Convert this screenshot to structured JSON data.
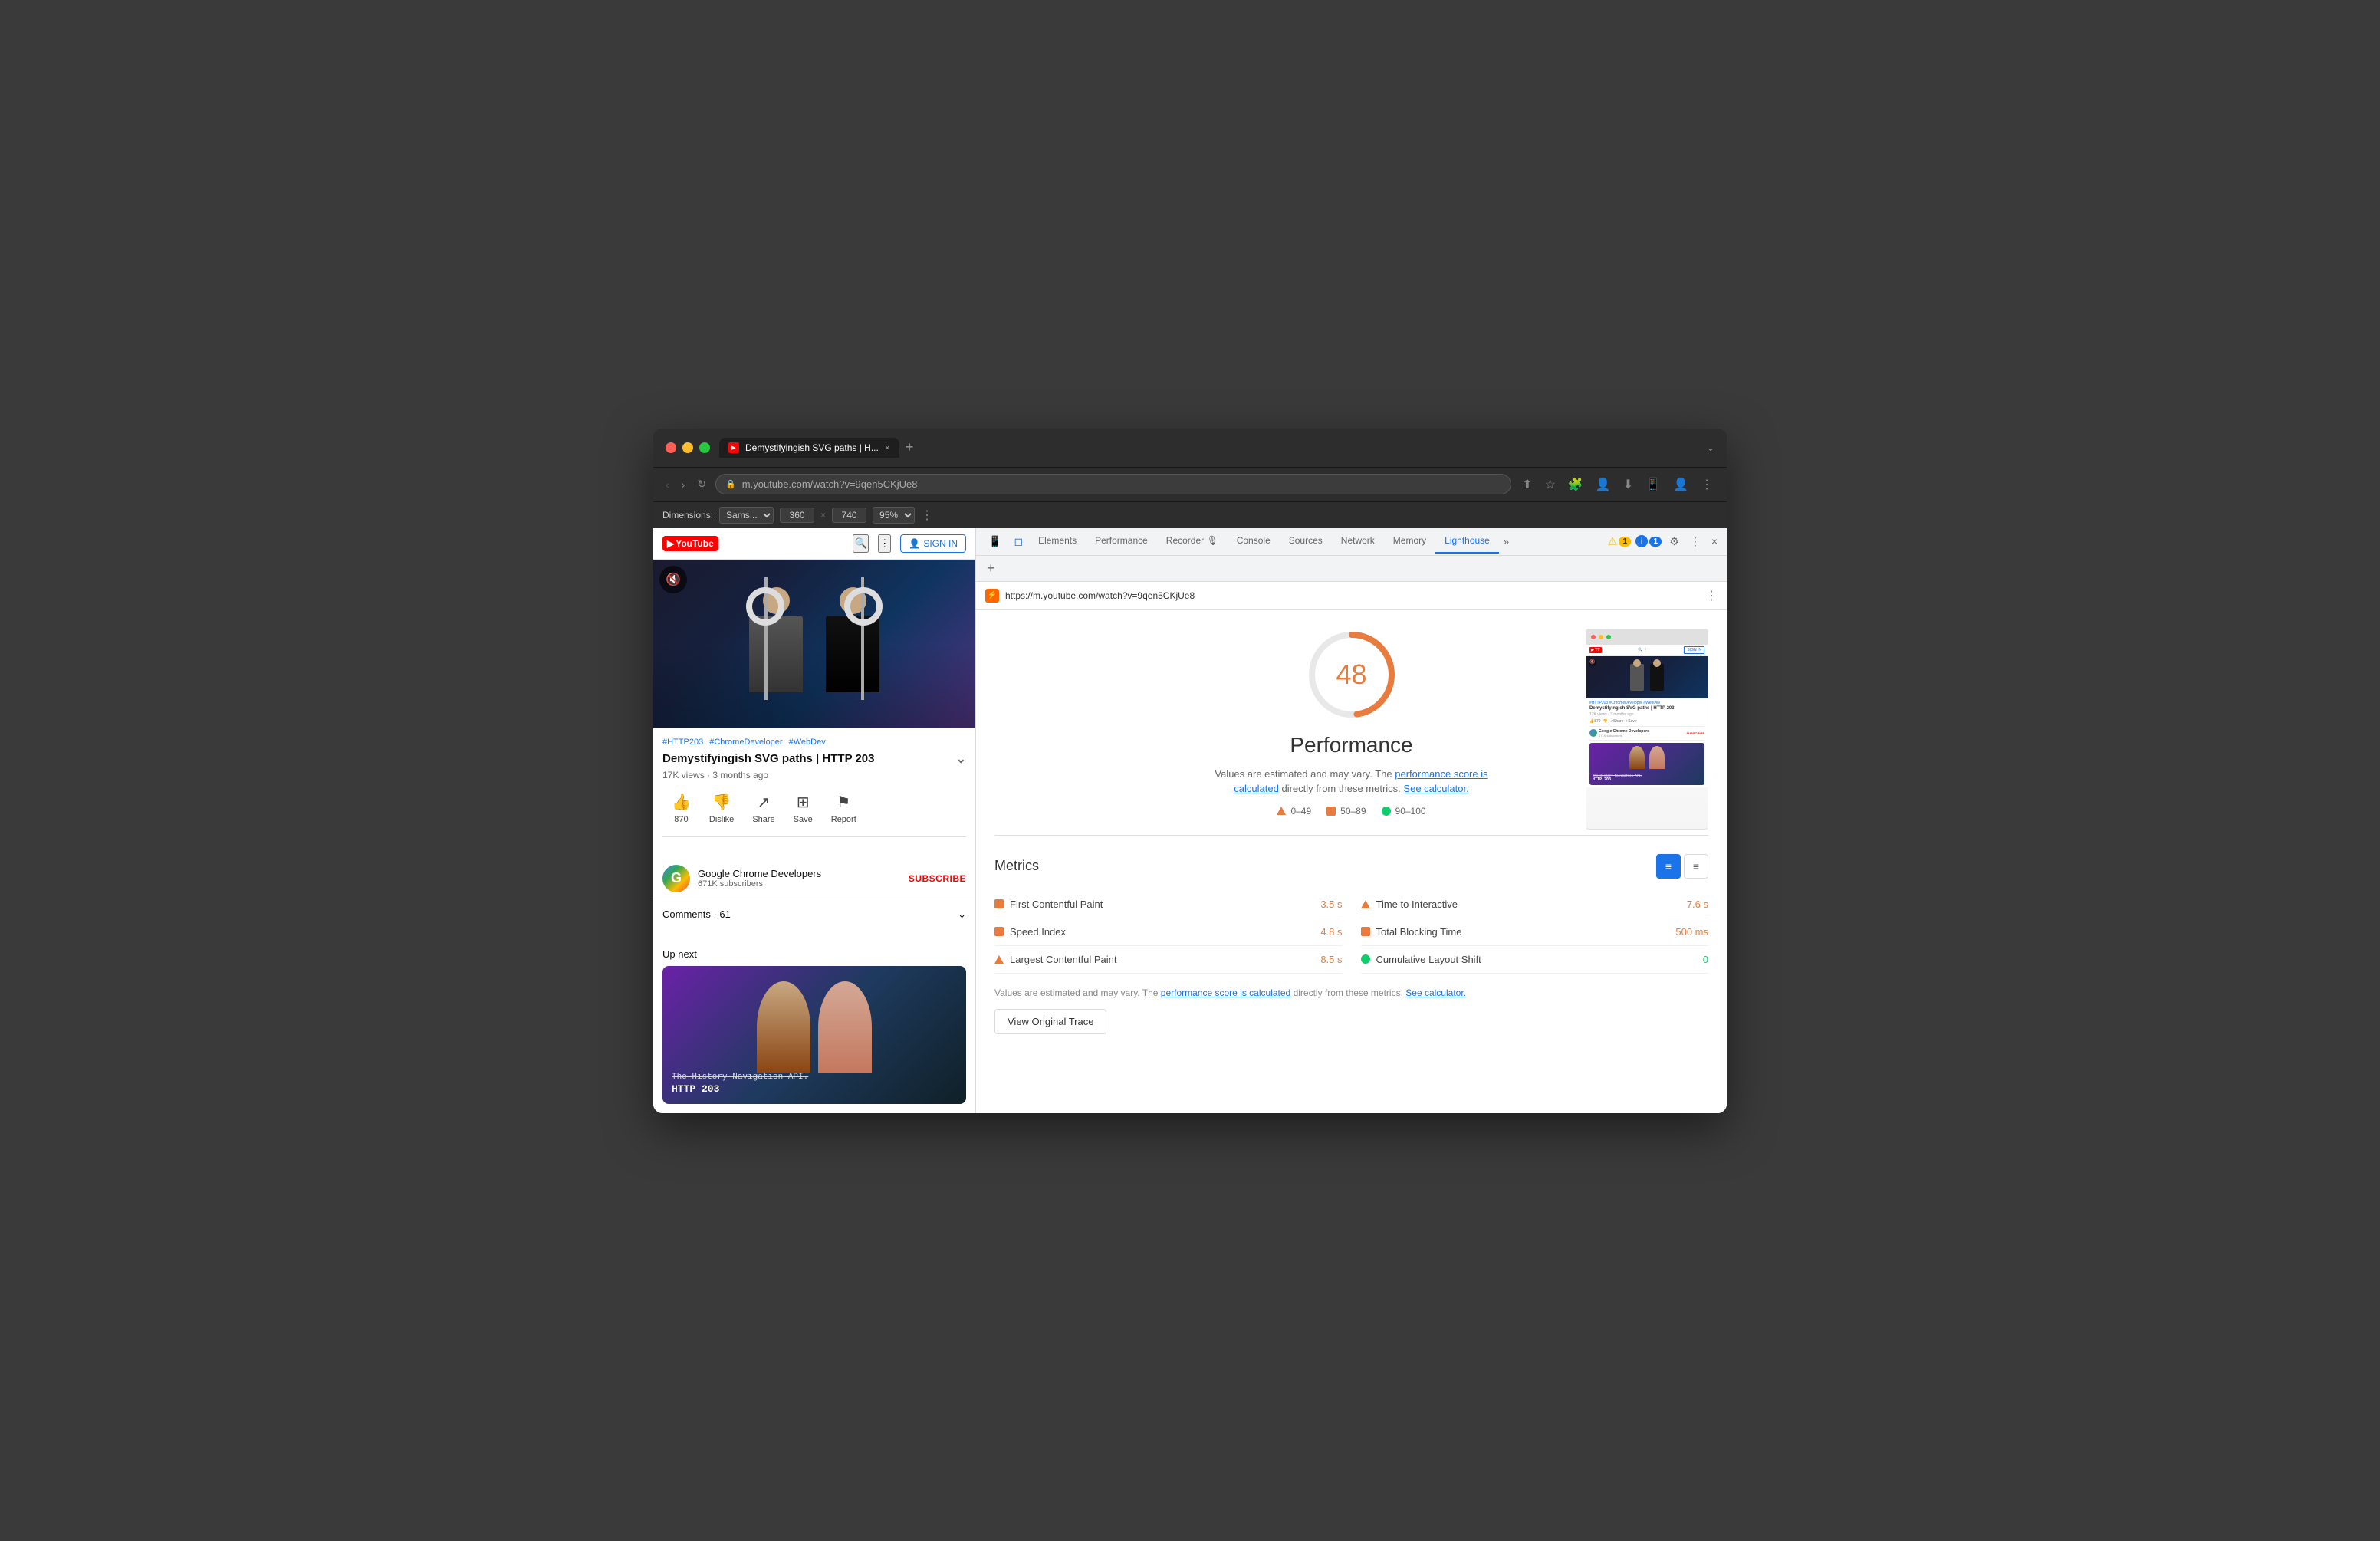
{
  "browser": {
    "traffic_lights": {
      "red": "close",
      "yellow": "minimize",
      "green": "maximize"
    },
    "tab": {
      "title": "Demystifyingish SVG paths | H...",
      "favicon": "youtube-favicon",
      "close": "×"
    },
    "nav": {
      "back": "‹",
      "forward": "›",
      "refresh": "↻",
      "url_full": "m.youtube.com/watch?v=9qen5CKjUe8",
      "url_protocol": "m.youtube.com",
      "url_path": "/watch?v=9qen5CKjUe8"
    },
    "nav_actions": {
      "share": "⬆",
      "bookmark": "☆",
      "extensions": "🧩",
      "person": "👤",
      "download": "⬇",
      "mobile": "📱",
      "profile": "👤",
      "menu": "⋮",
      "chevron": "⌄"
    }
  },
  "dimensions": {
    "label": "Dimensions:",
    "device": "Sams...",
    "width": "360",
    "height": "740",
    "zoom": "95%",
    "menu": "⋮"
  },
  "devtools": {
    "tabs": [
      "Elements",
      "Performance",
      "Recorder 🎙",
      "Console",
      "Sources",
      "Network",
      "Memory",
      "Lighthouse"
    ],
    "active_tab": "Lighthouse",
    "more_tabs": "»",
    "warning_badge": "1",
    "info_badge": "1",
    "settings_icon": "⚙",
    "more_icon": "⋮",
    "close_icon": "×",
    "add_tab": "+",
    "url": "https://m.youtube.com/watch?v=9qen5CKjUe8",
    "more_btn": "⋮"
  },
  "lighthouse": {
    "score": "48",
    "title": "Performance",
    "description_1": "Values are estimated and may vary. The",
    "link_1": "performance score is calculated",
    "description_2": "directly from these metrics.",
    "link_2": "See calculator.",
    "legend": {
      "red": "0–49",
      "orange": "50–89",
      "green": "90–100"
    },
    "metrics_title": "Metrics",
    "metrics": [
      {
        "name": "First Contentful Paint",
        "value": "3.5 s",
        "status": "orange"
      },
      {
        "name": "Speed Index",
        "value": "4.8 s",
        "status": "orange"
      },
      {
        "name": "Largest Contentful Paint",
        "value": "8.5 s",
        "status": "red"
      },
      {
        "name": "Time to Interactive",
        "value": "7.6 s",
        "status": "red"
      },
      {
        "name": "Total Blocking Time",
        "value": "500 ms",
        "status": "orange"
      },
      {
        "name": "Cumulative Layout Shift",
        "value": "0",
        "status": "green"
      }
    ],
    "values_note_1": "Values are estimated and may vary. The",
    "values_link": "performance score is calculated",
    "values_note_2": "directly from these metrics.",
    "values_link_2": "See calculator.",
    "view_trace_btn": "View Original Trace"
  },
  "youtube": {
    "logo": "YouTube",
    "title": "Demystifyingish SVG paths | HTTP 203",
    "tags": [
      "#HTTP203",
      "#ChromeDeveloper",
      "#WebDev"
    ],
    "views": "17K views",
    "time_ago": "3 months ago",
    "likes": "870",
    "dislike": "Dislike",
    "share": "Share",
    "save": "Save",
    "report": "Report",
    "channel_name": "Google Chrome Developers",
    "channel_subs": "671K subscribers",
    "subscribe": "SUBSCRIBE",
    "comments_label": "Comments",
    "comments_count": "61",
    "up_next": "Up next",
    "next_video_title_1": "The History Navigation API.",
    "next_video_title_2": "HTTP 203"
  }
}
